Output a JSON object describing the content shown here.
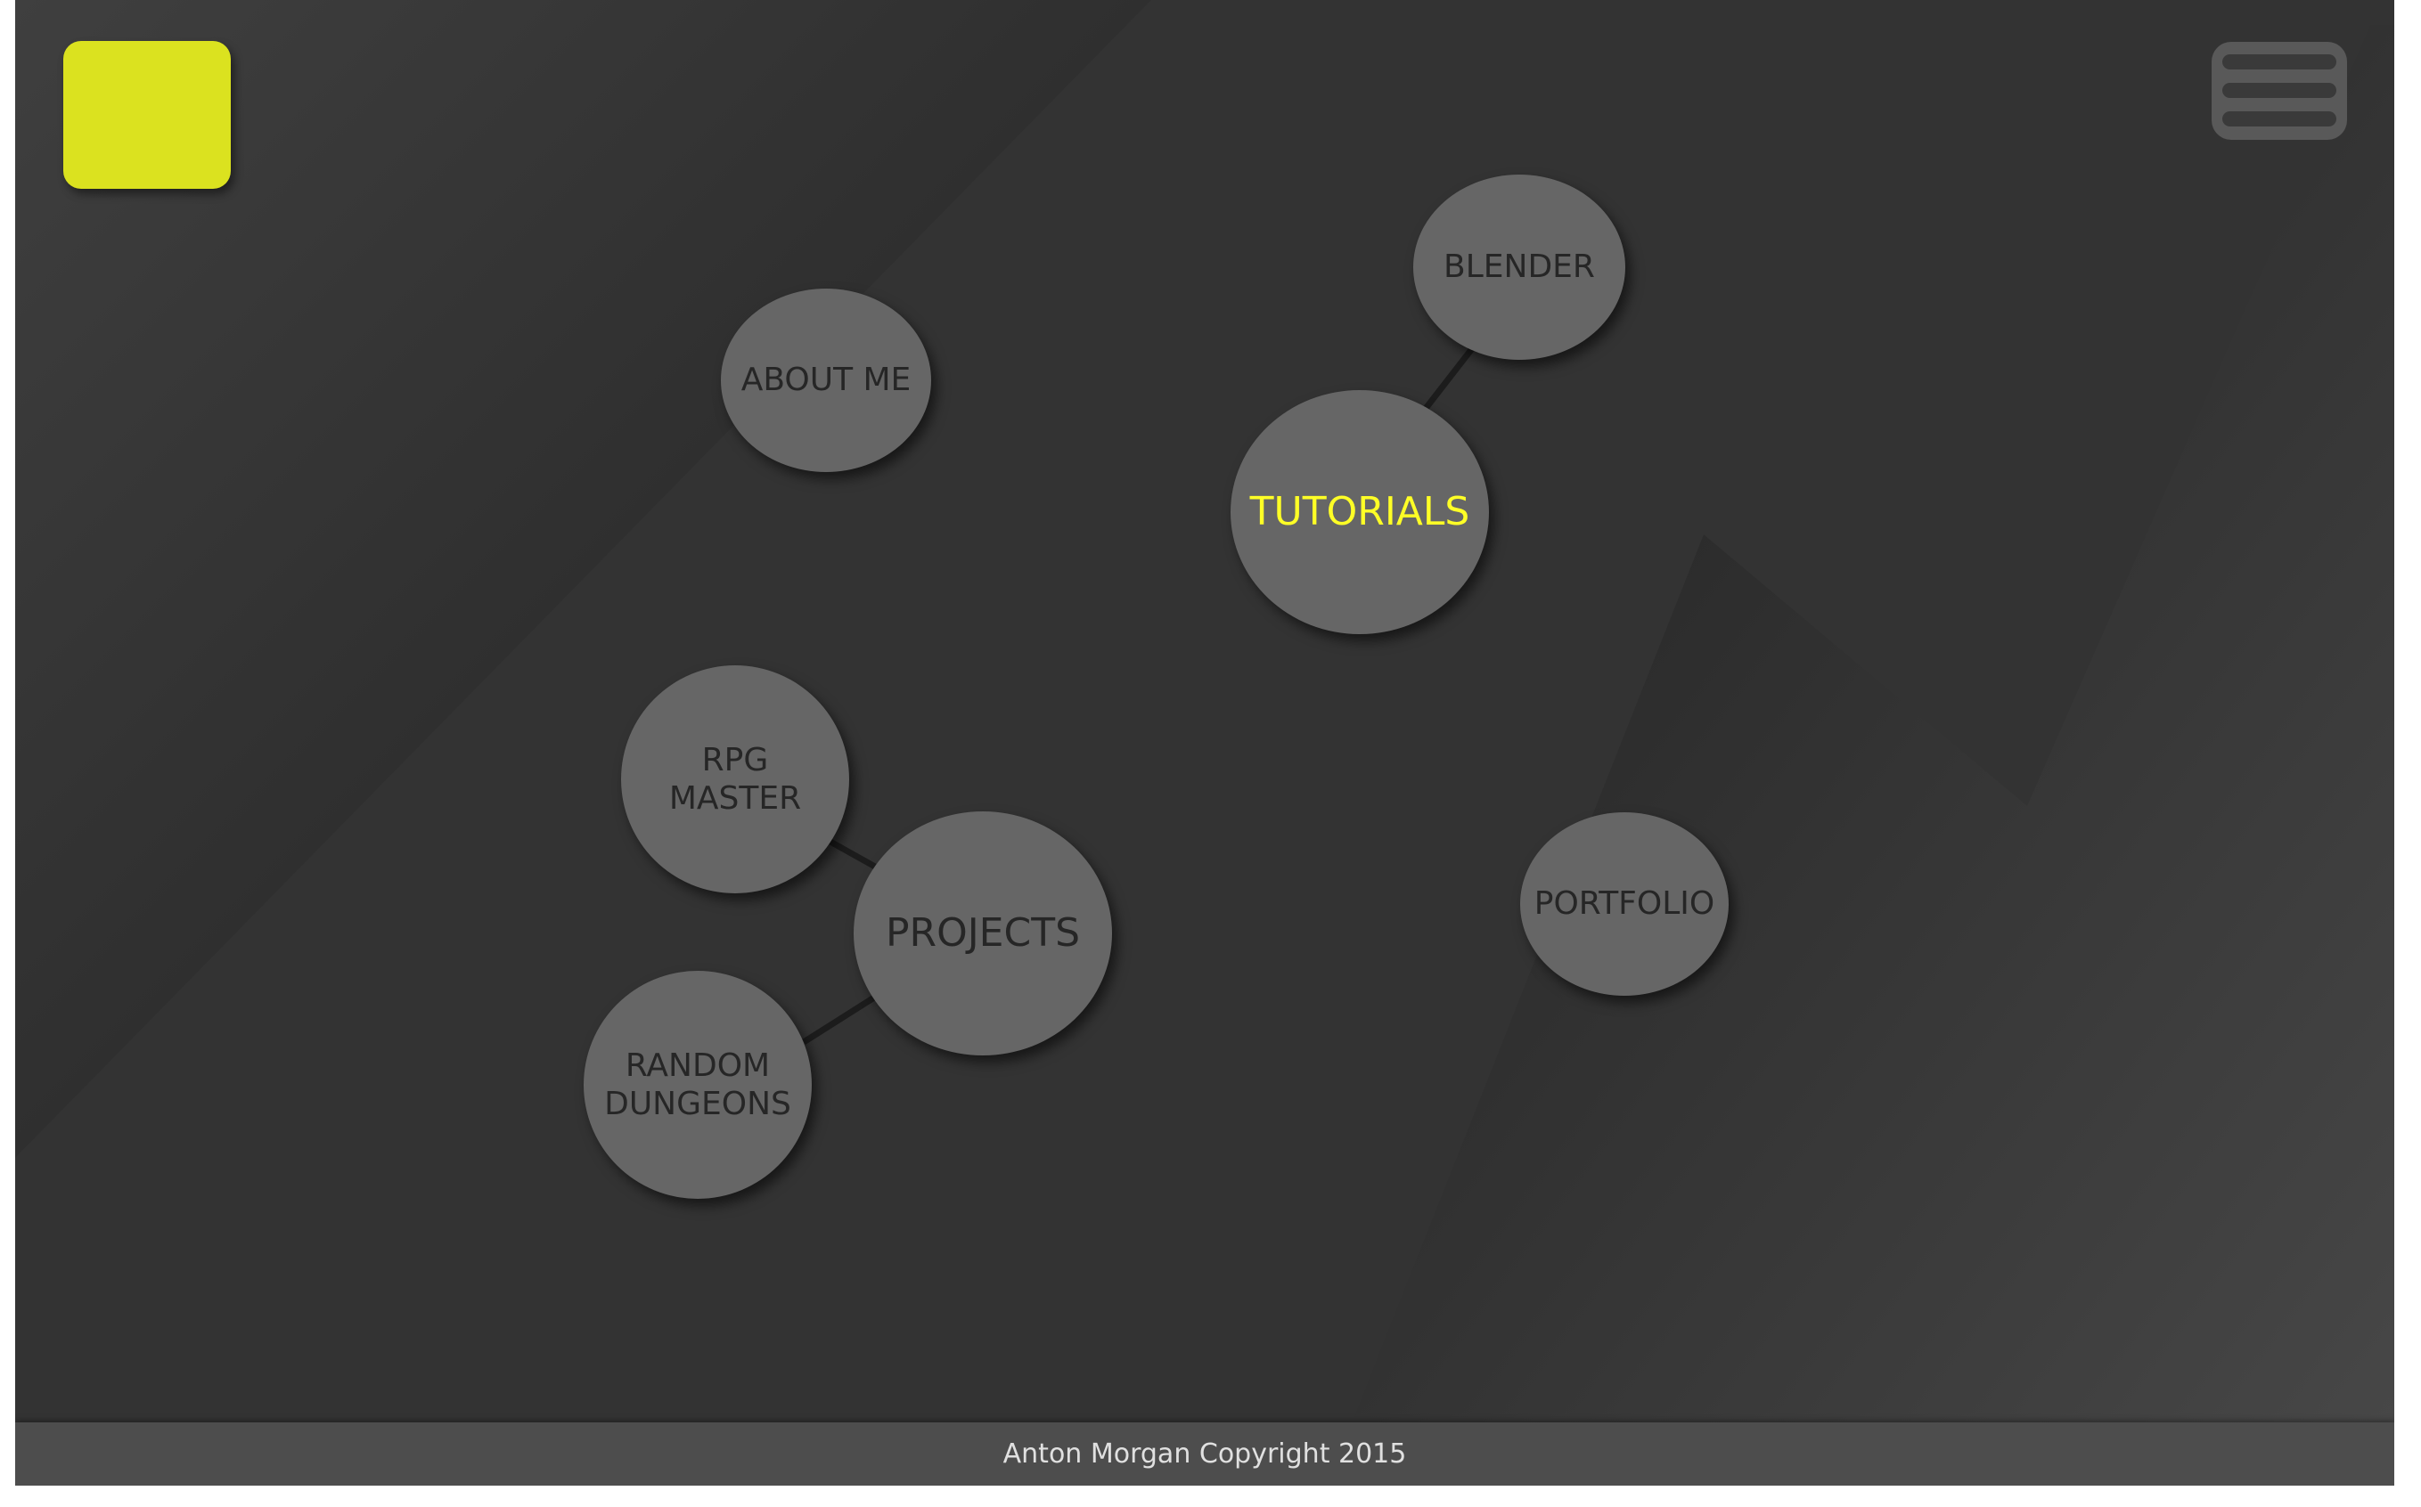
{
  "colors": {
    "background": "#333333",
    "logo": "#dbe21f",
    "node": "#666666",
    "node_text": "#262626",
    "active_text": "#ffff26",
    "footer": "#4d4d4d"
  },
  "header": {
    "logo_icon": "logo-square-icon",
    "menu_icon": "hamburger-menu-icon"
  },
  "nav": {
    "about": "ABOUT ME",
    "tutorials": "TUTORIALS",
    "blender": "BLENDER",
    "projects": "PROJECTS",
    "rpg_master": "RPG\nMASTER",
    "random_dungeons": "RANDOM\nDUNGEONS",
    "portfolio": "PORTFOLIO",
    "active": "tutorials"
  },
  "footer": {
    "copyright": "Anton Morgan Copyright 2015"
  }
}
